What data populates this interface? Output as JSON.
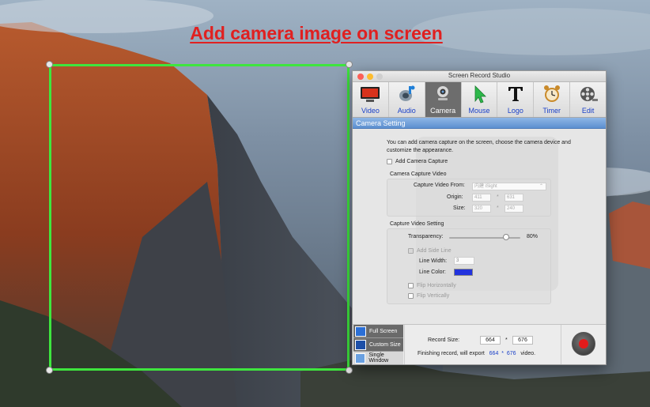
{
  "headline": "Add camera image on screen",
  "window": {
    "title": "Screen Record Studio"
  },
  "toolbar": [
    {
      "label": "Video",
      "icon": "monitor-icon"
    },
    {
      "label": "Audio",
      "icon": "microphone-icon"
    },
    {
      "label": "Camera",
      "icon": "webcam-icon",
      "active": true
    },
    {
      "label": "Mouse",
      "icon": "cursor-icon"
    },
    {
      "label": "Logo",
      "icon": "text-t-icon"
    },
    {
      "label": "Timer",
      "icon": "alarm-clock-icon"
    },
    {
      "label": "Edit",
      "icon": "film-reel-icon"
    }
  ],
  "section_title": "Camera Setting",
  "intro_text": "You can add camera capture on the screen, choose the camera device and customize the appearance.",
  "add_camera_capture": {
    "label": "Add Camera Capture",
    "checked": false
  },
  "camera_capture_video": {
    "title": "Camera Capture Video",
    "capture_from_label": "Capture Video From:",
    "capture_from_value": "内建 iSight",
    "origin_label": "Origin:",
    "origin_x": "411",
    "origin_y": "631",
    "size_label": "Size:",
    "size_w": "320",
    "size_h": "240",
    "times": "*"
  },
  "capture_video_setting": {
    "title": "Capture Video Setting",
    "transparency_label": "Transparency:",
    "transparency_value": "80%",
    "transparency": 0.8,
    "add_side_line": "Add Side Line",
    "line_width_label": "Line Width:",
    "line_width_value": "3",
    "line_color_label": "Line Color:",
    "line_color": "#2233dd",
    "flip_horizontally": "Flip Horizontally",
    "flip_vertically": "Flip Vertically"
  },
  "modes": [
    "Full Screen",
    "Custom Size",
    "Single Window"
  ],
  "record": {
    "size_label": "Record Size:",
    "width": "664",
    "height": "676",
    "times": "*",
    "export_prefix": "Finishing record, will export",
    "export_w": "664",
    "export_h": "676",
    "export_suffix": "video."
  },
  "colors": {
    "headline": "#e02020",
    "selection": "#3ee63e",
    "section_bar": "#5c8fd0",
    "record": "#e21b1b"
  }
}
